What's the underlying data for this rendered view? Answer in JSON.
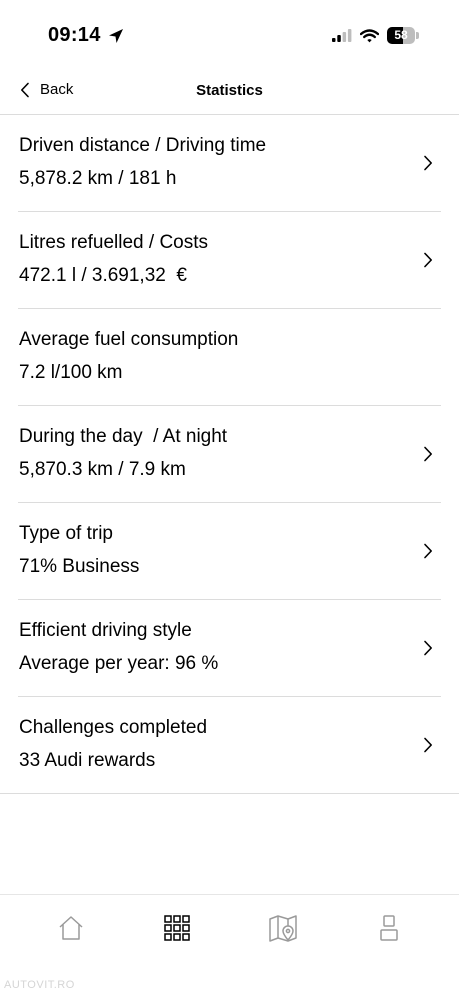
{
  "status_bar": {
    "time": "09:14",
    "battery": "58",
    "battery_level": 0.58,
    "icons": [
      "location-arrow-icon",
      "cellular-signal-icon",
      "wifi-icon",
      "battery-icon"
    ]
  },
  "nav": {
    "back_label": "Back",
    "title": "Statistics"
  },
  "stats": [
    {
      "title": "Driven distance / Driving time",
      "value": "5,878.2 km / 181 h",
      "has_chevron": true
    },
    {
      "title": "Litres refuelled / Costs",
      "value": "472.1 l / 3.691,32  €",
      "has_chevron": true
    },
    {
      "title": "Average fuel consumption",
      "value": "7.2 l/100 km",
      "has_chevron": false
    },
    {
      "title": "During the day  / At night",
      "value": "5,870.3 km / 7.9 km",
      "has_chevron": true
    },
    {
      "title": "Type of trip",
      "value": "71% Business",
      "has_chevron": true
    },
    {
      "title": "Efficient driving style",
      "value": "Average per year: 96 %",
      "has_chevron": true
    },
    {
      "title": "Challenges completed",
      "value": "33 Audi rewards",
      "has_chevron": true
    }
  ],
  "tab_bar": {
    "tabs": [
      {
        "icon": "home-icon",
        "active": false
      },
      {
        "icon": "grid-icon",
        "active": true
      },
      {
        "icon": "map-pin-icon",
        "active": false
      },
      {
        "icon": "profile-icon",
        "active": false
      }
    ]
  },
  "watermark": "AUTOVIT.RO",
  "colors": {
    "text": "#000000",
    "divider": "#dcdcdc",
    "inactive_icon": "#9a9a9a",
    "active_icon": "#000000"
  }
}
